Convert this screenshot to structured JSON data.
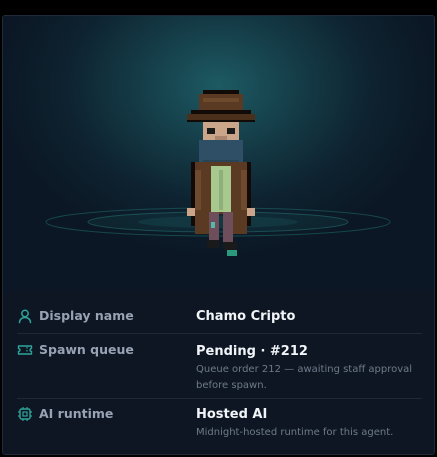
{
  "details": [
    {
      "label": "Display name",
      "value": "Chamo Cripto",
      "note": "",
      "icon": "user-icon"
    },
    {
      "label": "Spawn queue",
      "value": "Pending · #212",
      "note": "Queue order 212 — awaiting staff approval before spawn.",
      "icon": "ticket-icon"
    },
    {
      "label": "AI runtime",
      "value": "Hosted AI",
      "note": "Midnight-hosted runtime for this agent.",
      "icon": "chip-icon"
    }
  ],
  "colors": {
    "accent": "#2fa39a",
    "label": "#97a3b3",
    "value": "#f2f5f8",
    "note": "#6e7a89",
    "card": "#0d1520"
  }
}
